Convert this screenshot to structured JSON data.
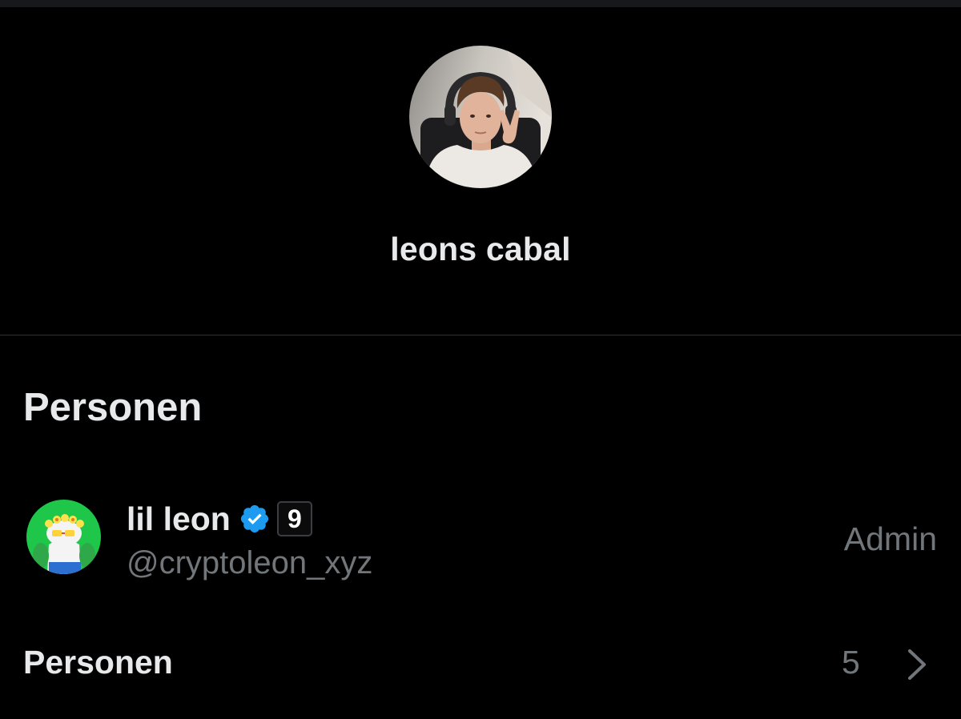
{
  "group": {
    "name": "leons cabal",
    "avatar_icon": "group-avatar-photo"
  },
  "people_section": {
    "title": "Personen"
  },
  "members": [
    {
      "name": "lil leon",
      "handle": "@cryptoleon_xyz",
      "affiliate_badge": "9",
      "role": "Admin",
      "verified_icon": "verified-badge-icon",
      "verified_color": "#1d9bf0",
      "avatar_bg": "#1ec64a"
    }
  ],
  "people_row": {
    "label": "Personen",
    "count": "5",
    "icon": "chevron-right-icon"
  },
  "colors": {
    "background": "#000000",
    "primary_text": "#e7e9ea",
    "secondary_text": "#71767b",
    "divider": "#2f3336"
  }
}
